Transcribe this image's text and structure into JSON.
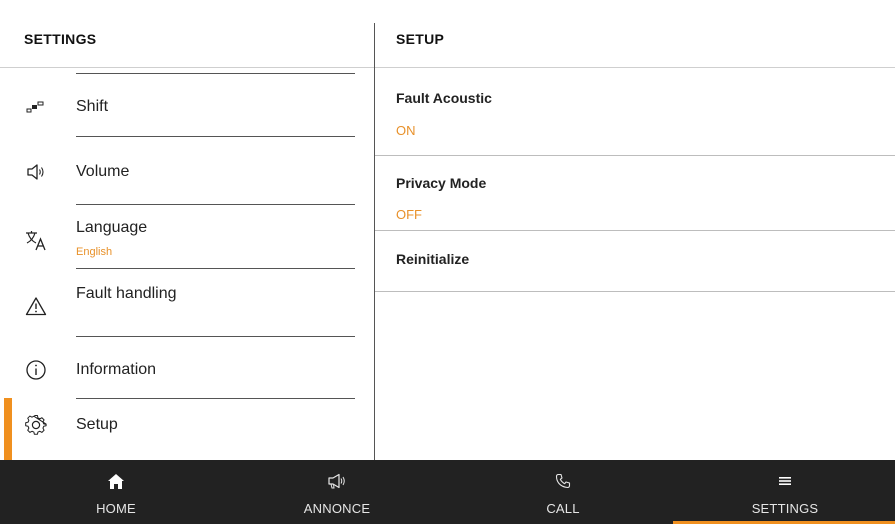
{
  "left": {
    "title": "SETTINGS",
    "items": [
      {
        "label": "Shift",
        "sub": "",
        "icon": "shift-icon"
      },
      {
        "label": "Volume",
        "sub": "",
        "icon": "volume-icon"
      },
      {
        "label": "Language",
        "sub": "English",
        "icon": "language-icon"
      },
      {
        "label": "Fault handling",
        "sub": "",
        "icon": "warning-icon"
      },
      {
        "label": "Information",
        "sub": "",
        "icon": "info-icon"
      },
      {
        "label": "Setup",
        "sub": "",
        "icon": "gear-icon",
        "active": true
      }
    ]
  },
  "right": {
    "title": "SETUP",
    "rows": [
      {
        "name": "Fault Acoustic",
        "value": "ON"
      },
      {
        "name": "Privacy Mode",
        "value": "OFF"
      },
      {
        "name": "Reinitialize",
        "value": ""
      }
    ]
  },
  "nav": {
    "items": [
      {
        "label": "HOME",
        "icon": "home-icon"
      },
      {
        "label": "ANNONCE",
        "icon": "megaphone-icon"
      },
      {
        "label": "CALL",
        "icon": "phone-icon"
      },
      {
        "label": "SETTINGS",
        "icon": "menu-icon",
        "active": true
      }
    ]
  },
  "colors": {
    "accent": "#f0901f",
    "nav_bg": "#222222",
    "value_text": "#e8912a"
  }
}
